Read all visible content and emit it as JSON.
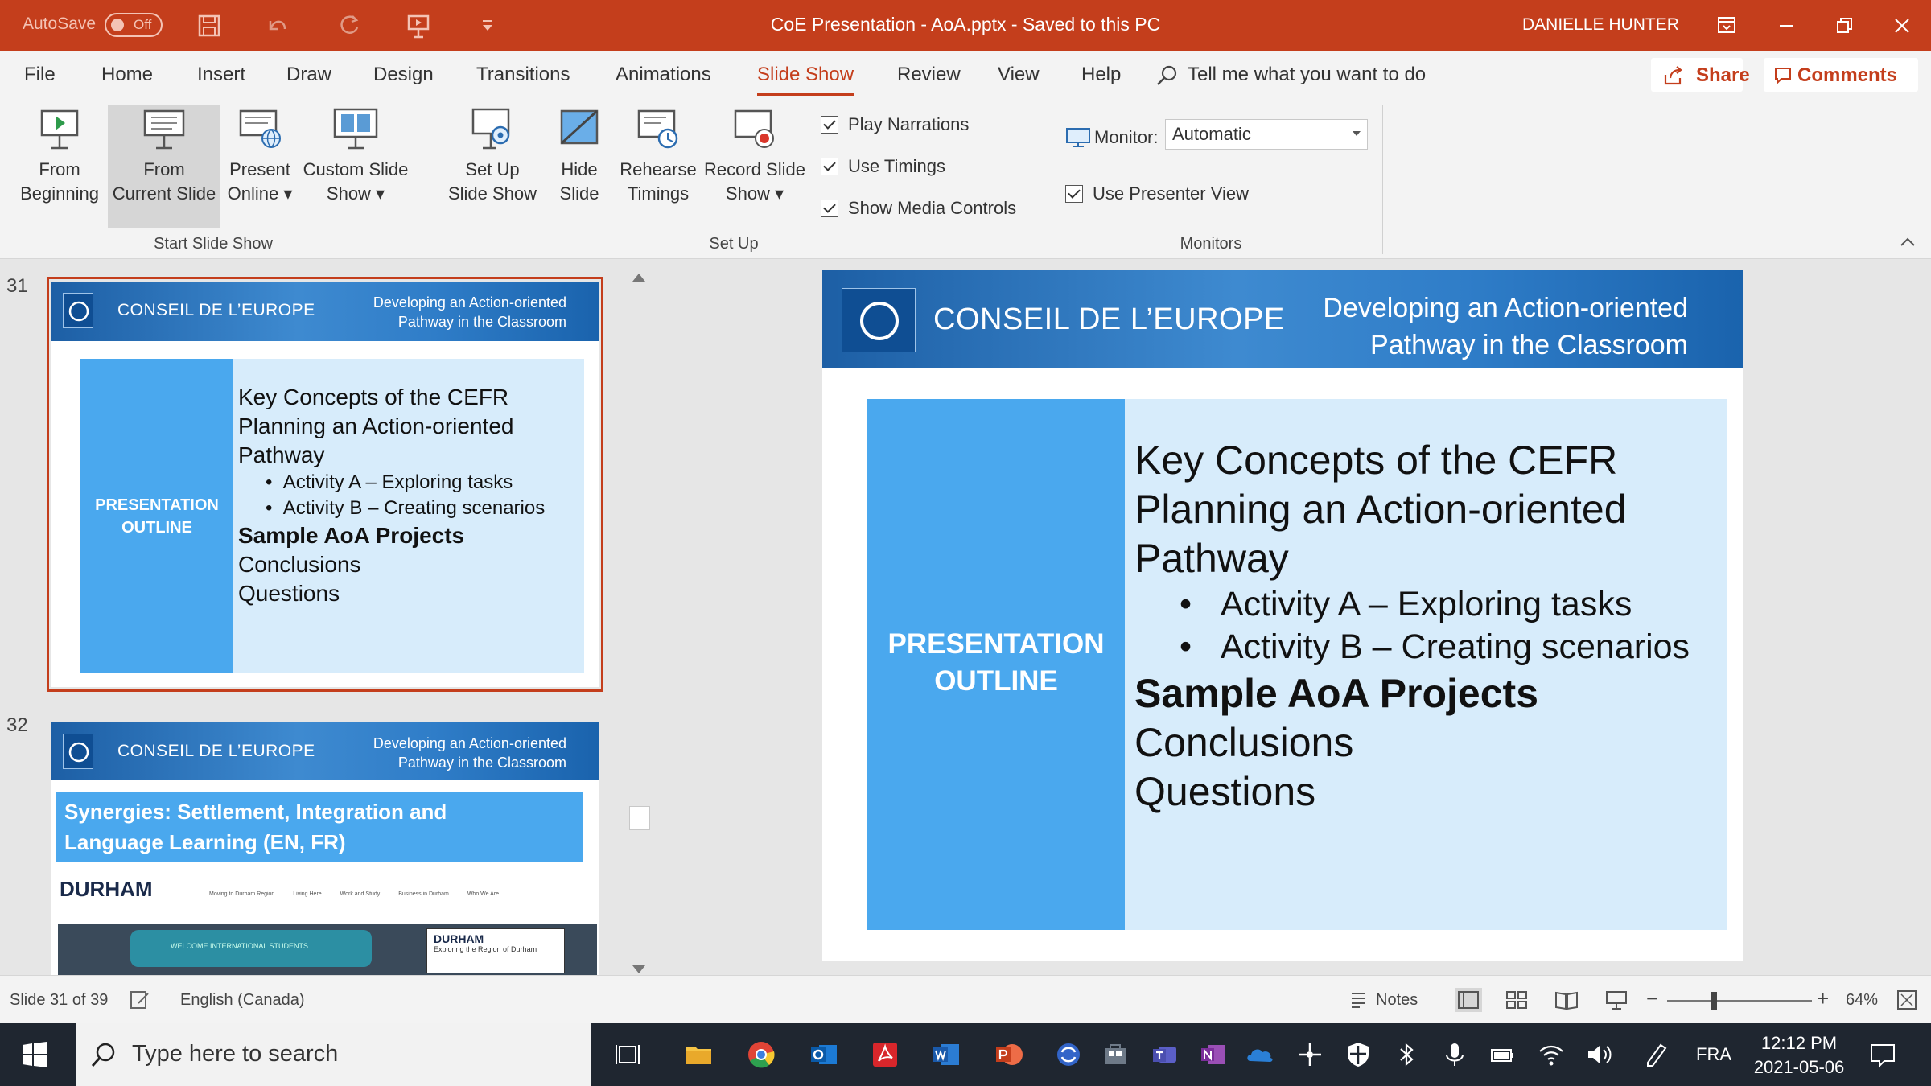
{
  "titlebar": {
    "autosave_label": "AutoSave",
    "autosave_state": "Off",
    "document_title": "CoE Presentation - AoA.pptx  -  Saved to this PC",
    "user_name": "DANIELLE HUNTER"
  },
  "ribbon_tabs": [
    "File",
    "Home",
    "Insert",
    "Draw",
    "Design",
    "Transitions",
    "Animations",
    "Slide Show",
    "Review",
    "View",
    "Help"
  ],
  "active_tab": "Slide Show",
  "tell_me": "Tell me what you want to do",
  "share_label": "Share",
  "comments_label": "Comments",
  "start_slide_show": {
    "group_label": "Start Slide Show",
    "from_beginning": [
      "From",
      "Beginning"
    ],
    "from_current": [
      "From",
      "Current Slide"
    ],
    "present_online": [
      "Present",
      "Online ▾"
    ],
    "custom_show": [
      "Custom Slide",
      "Show ▾"
    ]
  },
  "set_up": {
    "group_label": "Set Up",
    "setup_show": [
      "Set Up",
      "Slide Show"
    ],
    "hide_slide": [
      "Hide",
      "Slide"
    ],
    "rehearse": [
      "Rehearse",
      "Timings"
    ],
    "record": [
      "Record Slide",
      "Show ▾"
    ],
    "checkboxes": [
      {
        "label": "Play Narrations",
        "checked": true
      },
      {
        "label": "Use Timings",
        "checked": true
      },
      {
        "label": "Show Media Controls",
        "checked": true
      }
    ]
  },
  "monitors": {
    "group_label": "Monitors",
    "monitor_label": "Monitor:",
    "monitor_value": "Automatic",
    "presenter_view_label": "Use Presenter View",
    "presenter_view_checked": true
  },
  "thumbnails": [
    {
      "number": "31",
      "org": "CONSEIL DE L’EUROPE",
      "subtitle": [
        "Developing an Action-oriented",
        "Pathway in the Classroom"
      ],
      "left_panel": [
        "PRESENTATION",
        "OUTLINE"
      ],
      "lines": [
        "Key Concepts of the CEFR",
        "Planning an Action-oriented",
        "Pathway"
      ],
      "bullets": [
        "Activity A – Exploring tasks",
        "Activity B – Creating scenarios"
      ],
      "bold_line": "Sample AoA Projects",
      "tail_lines": [
        "Conclusions",
        "Questions"
      ]
    },
    {
      "number": "32",
      "org": "CONSEIL DE L’EUROPE",
      "subtitle": [
        "Developing an Action-oriented",
        "Pathway in the Classroom"
      ],
      "heading": [
        "Synergies: Settlement, Integration and",
        "Language Learning (EN, FR)"
      ],
      "site_logo": "DURHAM",
      "site_nav": [
        "Moving to Durham Region",
        "Living Here",
        "Work and Study",
        "Business in Durham",
        "Who We Are"
      ],
      "bus_text": "WELCOME INTERNATIONAL STUDENTS",
      "card_logo": "DURHAM",
      "card_text": "Exploring the Region of Durham"
    }
  ],
  "slide": {
    "org": "CONSEIL DE L’EUROPE",
    "subtitle": [
      "Developing an Action-oriented",
      "Pathway in the Classroom"
    ],
    "left_panel": [
      "PRESENTATION",
      "OUTLINE"
    ],
    "lines": [
      "Key Concepts of the CEFR",
      "Planning an Action-oriented",
      "Pathway"
    ],
    "bullets": [
      "Activity A – Exploring tasks",
      "Activity B – Creating scenarios"
    ],
    "bold_line": "Sample AoA Projects",
    "tail_lines": [
      "Conclusions",
      "Questions"
    ]
  },
  "status": {
    "slide_info": "Slide 31 of 39",
    "language": "English (Canada)",
    "notes_label": "Notes",
    "zoom": "64%",
    "zoom_level": 0.64
  },
  "taskbar": {
    "search_placeholder": "Type here to search",
    "language": "FRA",
    "time": "12:12 PM",
    "date": "2021-05-06"
  },
  "colors": {
    "accent": "#c43e1c",
    "banner_blue": "#2f7dc8",
    "outline_blue": "#4aa8ee",
    "outline_light": "#d7ecfb",
    "taskbar": "#1f2630"
  }
}
